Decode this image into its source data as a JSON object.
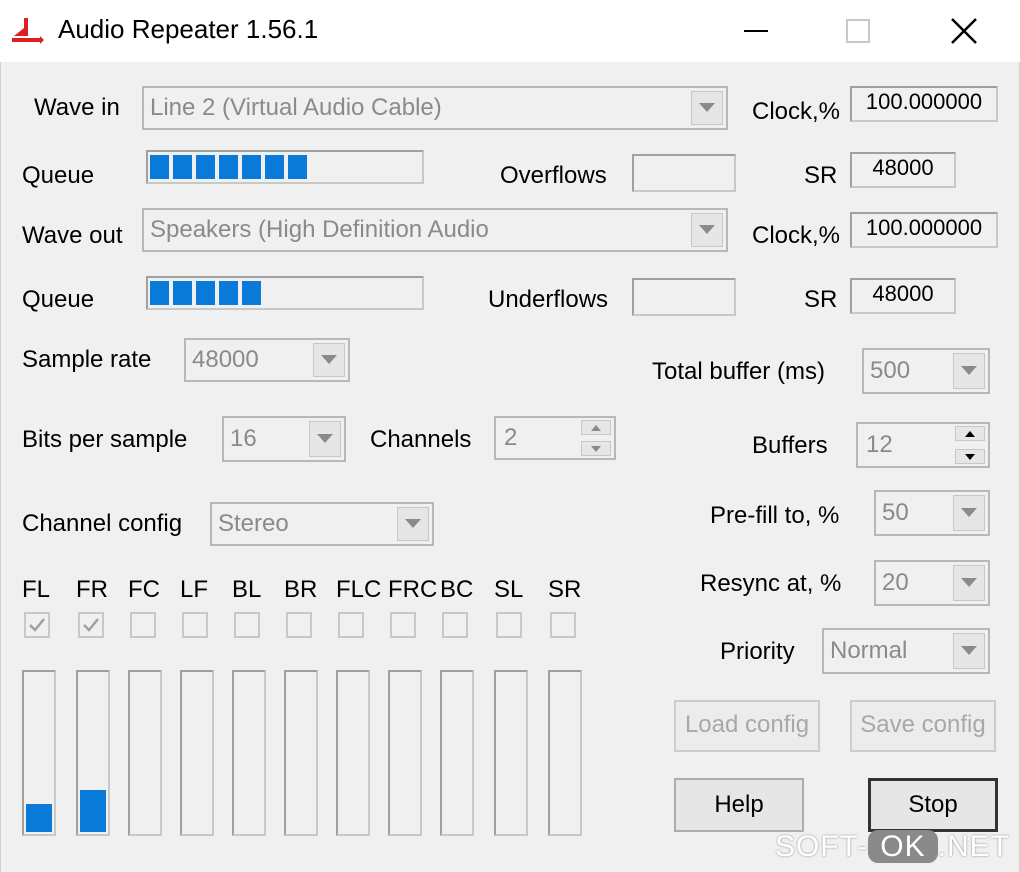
{
  "window": {
    "title": "Audio Repeater 1.56.1"
  },
  "wave_in": {
    "label": "Wave in",
    "device": "Line 2 (Virtual Audio Cable)",
    "clock_label": "Clock,%",
    "clock_value": "100.000000",
    "queue_label": "Queue",
    "queue_segments": 7,
    "overflows_label": "Overflows",
    "overflows_value": "",
    "sr_label": "SR",
    "sr_value": "48000"
  },
  "wave_out": {
    "label": "Wave out",
    "device": "Speakers (High Definition Audio",
    "clock_label": "Clock,%",
    "clock_value": "100.000000",
    "queue_label": "Queue",
    "queue_segments": 5,
    "underflows_label": "Underflows",
    "underflows_value": "",
    "sr_label": "SR",
    "sr_value": "48000"
  },
  "format": {
    "sample_rate_label": "Sample rate",
    "sample_rate": "48000",
    "bits_label": "Bits per sample",
    "bits": "16",
    "channels_label": "Channels",
    "channels": "2",
    "channel_config_label": "Channel config",
    "channel_config": "Stereo"
  },
  "channels": [
    {
      "name": "FL",
      "checked": true,
      "level": 0.17
    },
    {
      "name": "FR",
      "checked": true,
      "level": 0.26
    },
    {
      "name": "FC",
      "checked": false,
      "level": 0
    },
    {
      "name": "LF",
      "checked": false,
      "level": 0
    },
    {
      "name": "BL",
      "checked": false,
      "level": 0
    },
    {
      "name": "BR",
      "checked": false,
      "level": 0
    },
    {
      "name": "FLC",
      "checked": false,
      "level": 0
    },
    {
      "name": "FRC",
      "checked": false,
      "level": 0
    },
    {
      "name": "BC",
      "checked": false,
      "level": 0
    },
    {
      "name": "SL",
      "checked": false,
      "level": 0
    },
    {
      "name": "SR",
      "checked": false,
      "level": 0
    }
  ],
  "settings": {
    "total_buffer_label": "Total buffer (ms)",
    "total_buffer": "500",
    "buffers_label": "Buffers",
    "buffers": "12",
    "prefill_label": "Pre-fill to, %",
    "prefill": "50",
    "resync_label": "Resync at, %",
    "resync": "20",
    "priority_label": "Priority",
    "priority": "Normal"
  },
  "buttons": {
    "load_config": "Load config",
    "save_config": "Save config",
    "help": "Help",
    "stop": "Stop"
  },
  "watermark": {
    "prefix": "SOFT-",
    "ok": "OK",
    "suffix": ".NET"
  },
  "colors": {
    "meter_fill": "#0a7ad8",
    "dialog_bg": "#f0f0f0"
  }
}
